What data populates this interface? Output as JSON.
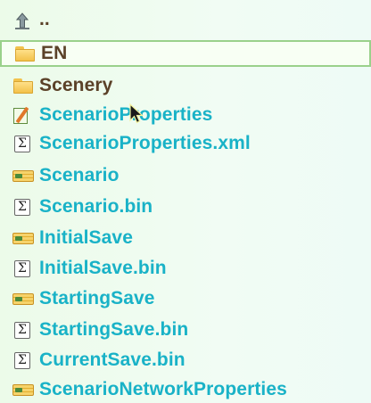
{
  "file_list": {
    "entries": [
      {
        "name": "..",
        "icon": "up-arrow-icon",
        "kind": "parent"
      },
      {
        "name": "EN",
        "icon": "folder-icon",
        "kind": "folder",
        "selected": true
      },
      {
        "name": "Scenery",
        "icon": "folder-icon",
        "kind": "folder"
      },
      {
        "name": "ScenarioProperties",
        "icon": "properties-icon",
        "kind": "file"
      },
      {
        "name": "ScenarioProperties.xml",
        "icon": "sigma-file-icon",
        "kind": "file"
      },
      {
        "name": "Scenario",
        "icon": "save-icon",
        "kind": "file"
      },
      {
        "name": "Scenario.bin",
        "icon": "sigma-file-icon",
        "kind": "file"
      },
      {
        "name": "InitialSave",
        "icon": "save-icon",
        "kind": "file"
      },
      {
        "name": "InitialSave.bin",
        "icon": "sigma-file-icon",
        "kind": "file"
      },
      {
        "name": "StartingSave",
        "icon": "save-icon",
        "kind": "file"
      },
      {
        "name": "StartingSave.bin",
        "icon": "sigma-file-icon",
        "kind": "file"
      },
      {
        "name": "CurrentSave.bin",
        "icon": "sigma-file-icon",
        "kind": "file"
      },
      {
        "name": "ScenarioNetworkProperties",
        "icon": "save-icon",
        "kind": "file"
      }
    ],
    "sigma_glyph": "Σ"
  },
  "colors": {
    "folder_text": "#5b4128",
    "file_text": "#19b2c7",
    "selection_border": "#9ad18b"
  }
}
